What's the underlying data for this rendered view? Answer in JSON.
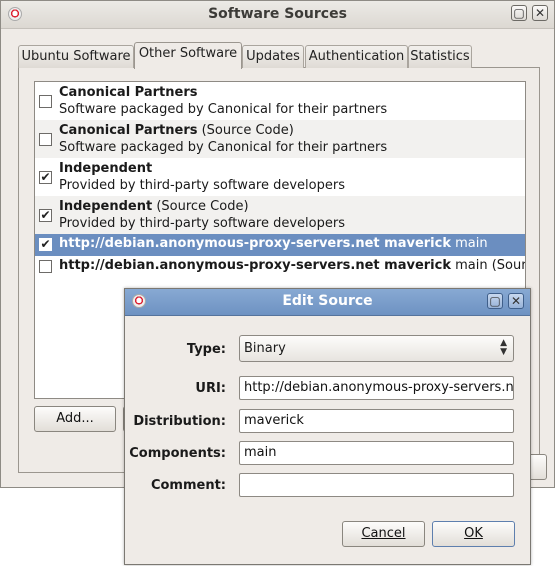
{
  "window": {
    "title": "Software Sources",
    "tabs": [
      {
        "label": "Ubuntu Software",
        "active": false
      },
      {
        "label": "Other Software",
        "active": true
      },
      {
        "label": "Updates",
        "active": false
      },
      {
        "label": "Authentication",
        "active": false
      },
      {
        "label": "Statistics",
        "active": false
      }
    ],
    "sources": [
      {
        "name": "Canonical Partners",
        "suffix": "",
        "description": "Software packaged by Canonical for their partners",
        "checked": false,
        "selected": false
      },
      {
        "name": "Canonical Partners",
        "suffix": " (Source Code)",
        "description": "Software packaged by Canonical for their partners",
        "checked": false,
        "selected": false
      },
      {
        "name": "Independent",
        "suffix": "",
        "description": "Provided by third-party software developers",
        "checked": true,
        "selected": false
      },
      {
        "name": "Independent",
        "suffix": " (Source Code)",
        "description": "Provided by third-party software developers",
        "checked": true,
        "selected": false
      },
      {
        "name": "http://debian.anonymous-proxy-servers.net maverick",
        "suffix": " main",
        "description": "",
        "checked": true,
        "selected": true
      },
      {
        "name": "http://debian.anonymous-proxy-servers.net maverick",
        "suffix": " main (Source Code)",
        "description": "",
        "checked": false,
        "selected": false
      }
    ],
    "add_label": "Add..."
  },
  "dialog": {
    "title": "Edit Source",
    "type_label": "Type:",
    "type_value": "Binary",
    "uri_label": "URI:",
    "uri_value": "http://debian.anonymous-proxy-servers.net",
    "distribution_label": "Distribution:",
    "distribution_value": "maverick",
    "components_label": "Components:",
    "components_value": "main",
    "comment_label": "Comment:",
    "comment_value": "",
    "cancel_label": "Cancel",
    "ok_label": "OK"
  },
  "icons": {
    "app": "software-sources-icon",
    "maximize": "maximize-icon",
    "close": "close-icon",
    "check": "✔",
    "combo": "up-down-arrows-icon"
  },
  "colors": {
    "selection": "#6b8ec0",
    "dialog_titlebar": "#7a9cca",
    "window_bg": "#efebe7"
  }
}
